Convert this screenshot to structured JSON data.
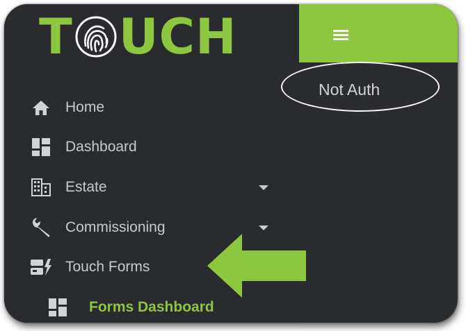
{
  "brand": {
    "letters_before": "T",
    "letters_after": "UCH",
    "color": "#8dc63f",
    "mark_icon": "fingerprint-icon"
  },
  "header": {
    "menu_icon": "hamburger-menu-icon",
    "color": "#8dc63f"
  },
  "main": {
    "status_text": "Not Auth"
  },
  "sidebar": {
    "items": [
      {
        "label": "Home",
        "icon": "home-icon"
      },
      {
        "label": "Dashboard",
        "icon": "dashboard-icon"
      },
      {
        "label": "Estate",
        "icon": "building-icon",
        "expandable": true
      },
      {
        "label": "Commissioning",
        "icon": "wrench-icon",
        "expandable": true
      },
      {
        "label": "Touch Forms",
        "icon": "touch-forms-icon"
      }
    ],
    "sub_items": [
      {
        "label": "Forms Dashboard",
        "icon": "dashboard-icon"
      }
    ]
  },
  "annotations": {
    "arrow_color": "#8dc63f",
    "highlight_oval_color": "#ffffff"
  }
}
